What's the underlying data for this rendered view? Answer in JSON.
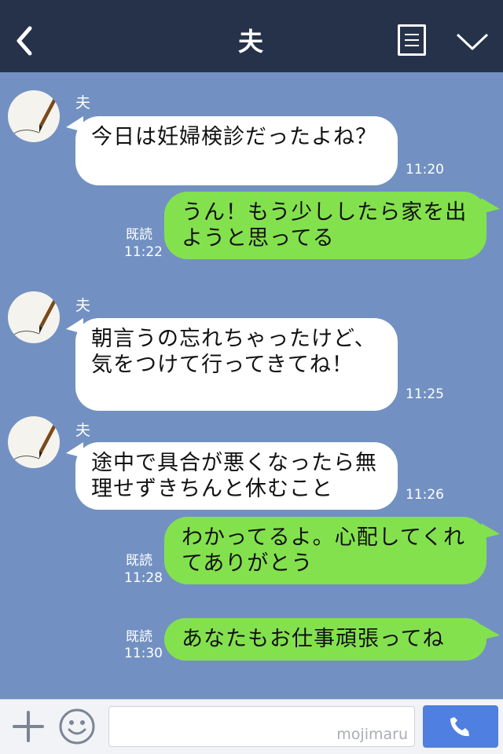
{
  "header": {
    "title": "夫"
  },
  "chat": {
    "messages": [
      {
        "sender": "夫",
        "text": "今日は妊婦検診だったよね？",
        "time": "11:20"
      },
      {
        "text": "うん！もう少ししたら家を出ようと思ってる",
        "read": "既読",
        "time": "11:22"
      },
      {
        "sender": "夫",
        "text": "朝言うの忘れちゃったけど、気をつけて行ってきてね！",
        "time": "11:25"
      },
      {
        "sender": "夫",
        "text": "途中で具合が悪くなったら無理せずきちんと休むこと",
        "time": "11:26"
      },
      {
        "text": "わかってるよ。心配してくれてありがとう",
        "read": "既読",
        "time": "11:28"
      },
      {
        "text": "あなたもお仕事頑張ってね",
        "read": "既読",
        "time": "11:30"
      }
    ]
  },
  "input": {
    "watermark": "mojimaru"
  },
  "colors": {
    "header": "#263249",
    "chat_bg": "#7291c2",
    "out_bubble": "#84e14e",
    "in_bubble": "#ffffff",
    "send_button": "#4f7fe0"
  },
  "icons": [
    "back-icon",
    "menu-icon",
    "chevron-down-icon",
    "plus-icon",
    "smile-icon",
    "phone-icon"
  ]
}
